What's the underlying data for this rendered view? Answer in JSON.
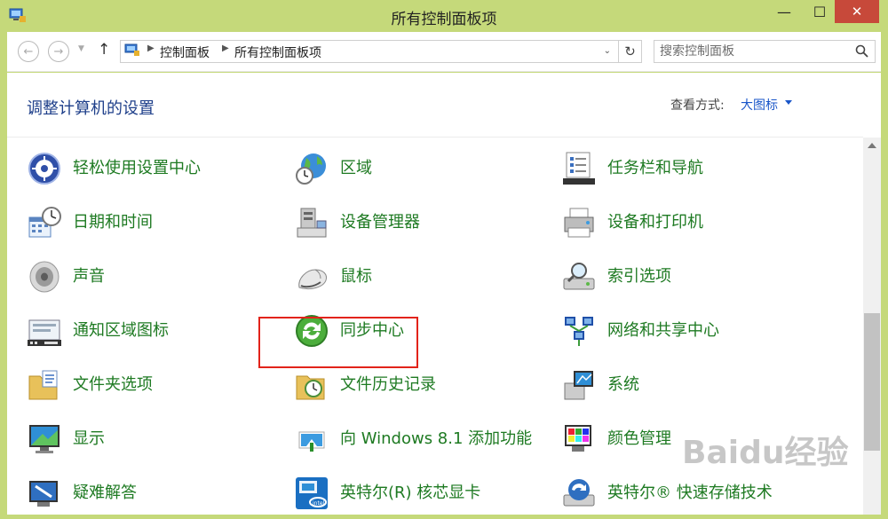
{
  "window": {
    "title": "所有控制面板项",
    "min_glyph": "—",
    "max_glyph": "☐",
    "close_glyph": "✕",
    "close_color": "#c7493a"
  },
  "addressbar": {
    "back_glyph": "←",
    "forward_glyph": "→",
    "up_glyph": "↑",
    "breadcrumbs": [
      "控制面板",
      "所有控制面板项"
    ],
    "refresh_glyph": "↻",
    "search_placeholder": "搜索控制面板"
  },
  "main": {
    "heading": "调整计算机的设置",
    "view_by_label": "查看方式:",
    "view_by_value": "大图标",
    "accent_color": "#1a56c9",
    "item_color": "#1e7a22",
    "items": [
      {
        "label": "轻松使用设置中心",
        "icon": "ease-of-access-icon"
      },
      {
        "label": "区域",
        "icon": "region-globe-icon"
      },
      {
        "label": "任务栏和导航",
        "icon": "taskbar-icon"
      },
      {
        "label": "日期和时间",
        "icon": "date-time-icon"
      },
      {
        "label": "设备管理器",
        "icon": "device-manager-icon"
      },
      {
        "label": "设备和打印机",
        "icon": "printer-icon"
      },
      {
        "label": "声音",
        "icon": "speaker-icon"
      },
      {
        "label": "鼠标",
        "icon": "mouse-icon"
      },
      {
        "label": "索引选项",
        "icon": "indexing-icon"
      },
      {
        "label": "通知区域图标",
        "icon": "notification-area-icon"
      },
      {
        "label": "同步中心",
        "icon": "sync-center-icon"
      },
      {
        "label": "网络和共享中心",
        "icon": "network-icon"
      },
      {
        "label": "文件夹选项",
        "icon": "folder-options-icon"
      },
      {
        "label": "文件历史记录",
        "icon": "file-history-icon"
      },
      {
        "label": "系统",
        "icon": "system-icon"
      },
      {
        "label": "显示",
        "icon": "display-icon"
      },
      {
        "label": "向 Windows 8.1 添加功能",
        "icon": "add-features-icon"
      },
      {
        "label": "颜色管理",
        "icon": "color-management-icon"
      },
      {
        "label": "疑难解答",
        "icon": "troubleshooting-icon"
      },
      {
        "label": "英特尔(R) 核芯显卡",
        "icon": "intel-graphics-icon"
      },
      {
        "label": "英特尔® 快速存储技术",
        "icon": "intel-storage-icon"
      }
    ]
  },
  "watermark": {
    "text": "Baidu经验"
  }
}
